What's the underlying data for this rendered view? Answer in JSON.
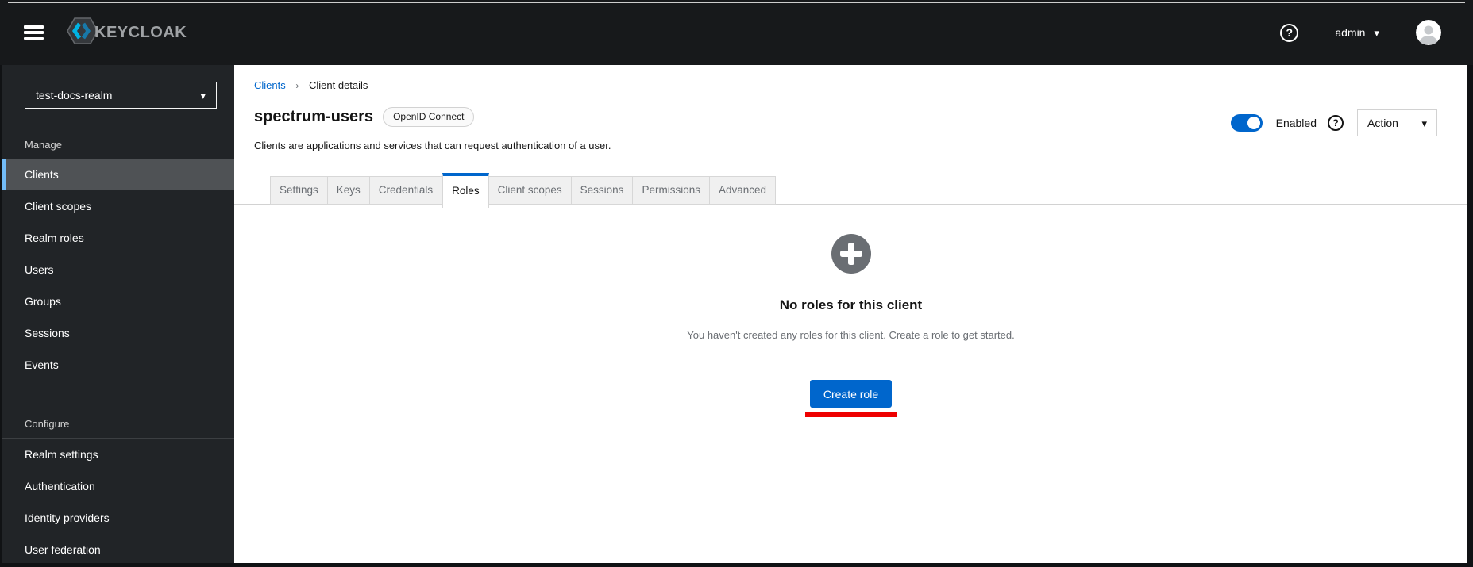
{
  "topbar": {
    "brand": "KEYCLOAK",
    "username": "admin"
  },
  "sidebar": {
    "realm": "test-docs-realm",
    "sections": [
      {
        "label": "Manage",
        "active": "Clients",
        "divider_below_label": false,
        "items": [
          "Clients",
          "Client scopes",
          "Realm roles",
          "Users",
          "Groups",
          "Sessions",
          "Events"
        ]
      },
      {
        "label": "Configure",
        "active": "",
        "divider_below_label": true,
        "items": [
          "Realm settings",
          "Authentication",
          "Identity providers",
          "User federation"
        ]
      }
    ]
  },
  "breadcrumb": {
    "link": "Clients",
    "separator": "›",
    "current": "Client details"
  },
  "header": {
    "title": "spectrum-users",
    "badge": "OpenID Connect",
    "subtitle": "Clients are applications and services that can request authentication of a user.",
    "enabled_label": "Enabled",
    "toggle_state": "on",
    "action_label": "Action"
  },
  "tabs": {
    "active": "Roles",
    "items": [
      "Settings",
      "Keys",
      "Credentials",
      "Roles",
      "Client scopes",
      "Sessions",
      "Permissions",
      "Advanced"
    ]
  },
  "empty_state": {
    "title": "No roles for this client",
    "description": "You haven't created any roles for this client. Create a role to get started.",
    "button": "Create role"
  },
  "colors": {
    "accent_blue": "#0066cc",
    "nav_active_border": "#73bcf7",
    "annotation_red": "#ee0000",
    "muted_gray": "#6a6e73",
    "sidebar_bg": "#212427",
    "topbar_bg": "#17191b"
  }
}
